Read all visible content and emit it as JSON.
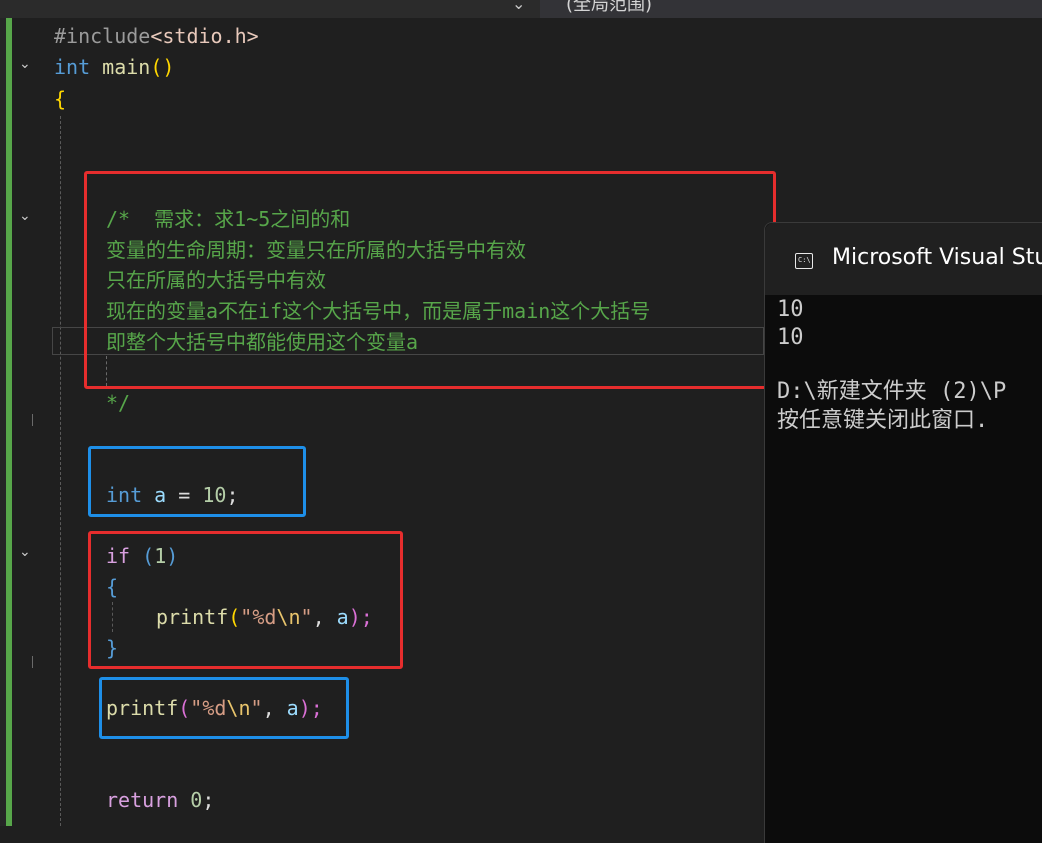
{
  "topbar": {
    "scope_label": "(全局范围)"
  },
  "code": {
    "include_directive": "#include",
    "include_header": "<stdio.h>",
    "int_kw": "int",
    "main_fn": "main",
    "main_parens": "()",
    "open_brace": "{",
    "comment_lines": [
      "/*  需求：求1~5之间的和",
      "变量的生命周期：变量只在所属的大括号中有效",
      "只在所属的大括号中有效",
      "现在的变量a不在if这个大括号中，而是属于main这个大括号",
      "即整个大括号中都能使用这个变量a",
      "*/"
    ],
    "decl": {
      "type": "int",
      "name": "a",
      "op": " = ",
      "value": "10",
      "end": ";"
    },
    "if_kw": "if",
    "if_cond_open": " (",
    "if_cond_value": "1",
    "if_cond_close": ")",
    "inner_open": "{",
    "inner_close": "}",
    "printf_fn": "printf",
    "printf_str": "\"%d",
    "printf_esc": "\\n",
    "printf_str_end": "\"",
    "printf_comma": ", ",
    "printf_arg": "a",
    "printf_end": ");",
    "paren_open": "(",
    "return_kw": "return",
    "return_value": "0",
    "return_end": ";"
  },
  "console": {
    "title": "Microsoft Visual Stu",
    "lines": [
      "10",
      "10",
      "",
      "D:\\新建文件夹 (2)\\P",
      "按任意键关闭此窗口."
    ]
  }
}
